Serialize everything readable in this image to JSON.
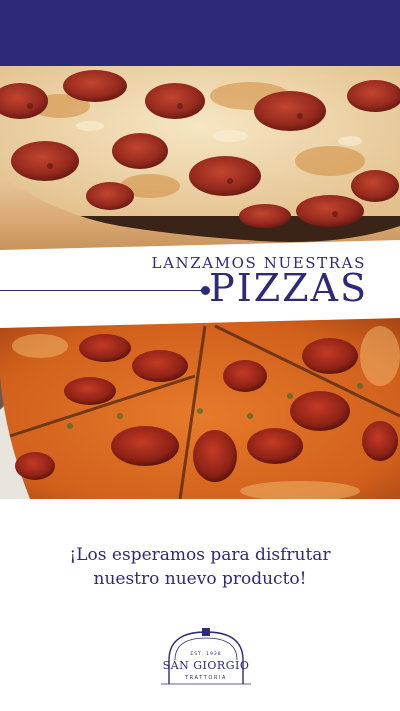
{
  "colors": {
    "brand": "#2e2a78",
    "background": "#ffffff"
  },
  "photos": {
    "top": {
      "icon": "pepperoni-pizza-closeup-photo"
    },
    "bottom": {
      "icon": "sliced-pepperoni-pizza-photo"
    }
  },
  "headline": {
    "kicker": "LANZAMOS NUESTRAS",
    "title": "PIZZAS"
  },
  "invite": {
    "line1": "¡Los esperamos para disfrutar",
    "line2": "nuestro nuevo producto!"
  },
  "logo": {
    "icon": "dome-oven-logo-icon",
    "est": "EST. 1938",
    "name": "SAN GIORGIO",
    "sub": "TRATTORIA"
  }
}
